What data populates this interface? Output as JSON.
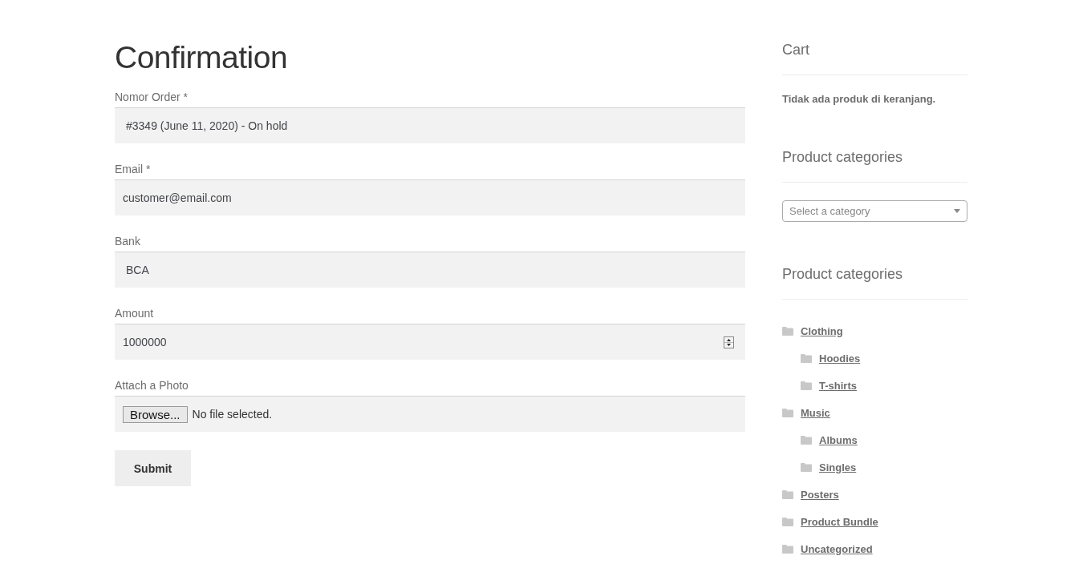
{
  "page": {
    "title": "Confirmation"
  },
  "form": {
    "fields": [
      {
        "kind": "select",
        "label": "Nomor Order *",
        "value": "#3349 (June 11, 2020) - On hold"
      },
      {
        "kind": "text",
        "label": "Email *",
        "value": "customer@email.com"
      },
      {
        "kind": "select",
        "label": "Bank",
        "value": "BCA"
      },
      {
        "kind": "number",
        "label": "Amount",
        "value": "1000000"
      },
      {
        "kind": "file",
        "label": "Attach a Photo",
        "button": "Browse...",
        "value": "No file selected."
      }
    ],
    "submit": "Submit"
  },
  "sidebar": {
    "cart": {
      "title": "Cart",
      "message": "Tidak ada produk di keranjang."
    },
    "category_select": {
      "title": "Product categories",
      "placeholder": "Select a category"
    },
    "category_list": {
      "title": "Product categories",
      "items": [
        {
          "label": "Clothing",
          "children": [
            {
              "label": "Hoodies"
            },
            {
              "label": "T-shirts"
            }
          ]
        },
        {
          "label": "Music",
          "children": [
            {
              "label": "Albums"
            },
            {
              "label": "Singles"
            }
          ]
        },
        {
          "label": "Posters"
        },
        {
          "label": "Product Bundle"
        },
        {
          "label": "Uncategorized"
        }
      ]
    }
  }
}
